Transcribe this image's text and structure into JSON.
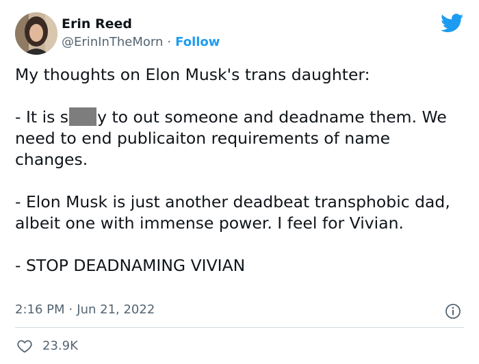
{
  "author": {
    "name": "Erin Reed",
    "handle": "@ErinInTheMorn",
    "separator": "·",
    "follow_label": "Follow"
  },
  "tweet": {
    "line1": "My thoughts on Elon Musk's trans daughter:",
    "p2_prefix": "- It is s",
    "p2_suffix": "y to out someone and deadname them. We need to end publicaiton requirements of name changes.",
    "p3": "- Elon Musk is just another deadbeat transphobic dad, albeit one with immense power. I feel for Vivian.",
    "p4": "- STOP DEADNAMING VIVIAN"
  },
  "meta": {
    "time": "2:16 PM",
    "separator": "·",
    "date": "Jun 21, 2022"
  },
  "engagement": {
    "likes": "23.9K"
  },
  "icons": {
    "brand": "twitter-bird-icon",
    "info": "info-icon",
    "like": "heart-icon"
  },
  "colors": {
    "accent": "#1d9bf0",
    "text": "#0f1419",
    "muted": "#536471",
    "divider": "#cfd9de",
    "censor": "#7d7d7d"
  }
}
